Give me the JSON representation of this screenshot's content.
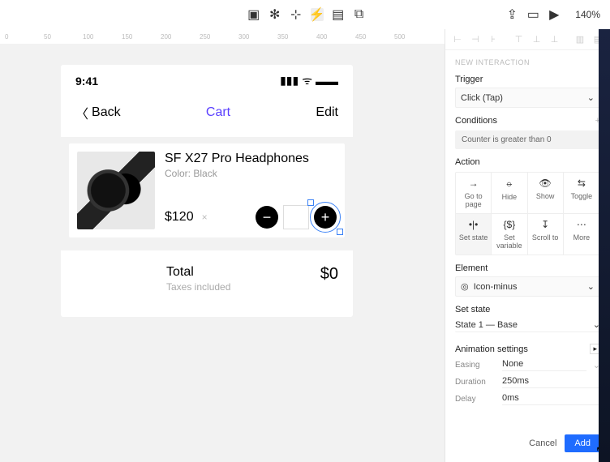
{
  "topbar": {
    "zoom": "140%"
  },
  "ruler": [
    "0",
    "50",
    "100",
    "150",
    "200",
    "250",
    "300",
    "350",
    "400",
    "450",
    "500"
  ],
  "device": {
    "status_time": "9:41",
    "nav": {
      "back": "Back",
      "title": "Cart",
      "edit": "Edit"
    },
    "product": {
      "name": "SF X27 Pro Headphones",
      "color": "Color: Black",
      "price": "$120"
    },
    "totals": {
      "label": "Total",
      "sub": "Taxes included",
      "value": "$0"
    }
  },
  "panel": {
    "heading": "NEW INTERACTION",
    "trigger_label": "Trigger",
    "trigger_value": "Click (Tap)",
    "conditions_label": "Conditions",
    "condition_chip": "Counter is greater than 0",
    "action_label": "Action",
    "actions": [
      "Go to page",
      "Hide",
      "Show",
      "Toggle",
      "Set state",
      "Set variable",
      "Scroll to",
      "More"
    ],
    "element_label": "Element",
    "element_value": "Icon-minus",
    "setstate_label": "Set state",
    "setstate_value": "State 1 — Base",
    "anim_label": "Animation settings",
    "easing_label": "Easing",
    "easing_value": "None",
    "duration_label": "Duration",
    "duration_value": "250ms",
    "delay_label": "Delay",
    "delay_value": "0ms",
    "cancel": "Cancel",
    "add": "Add"
  }
}
